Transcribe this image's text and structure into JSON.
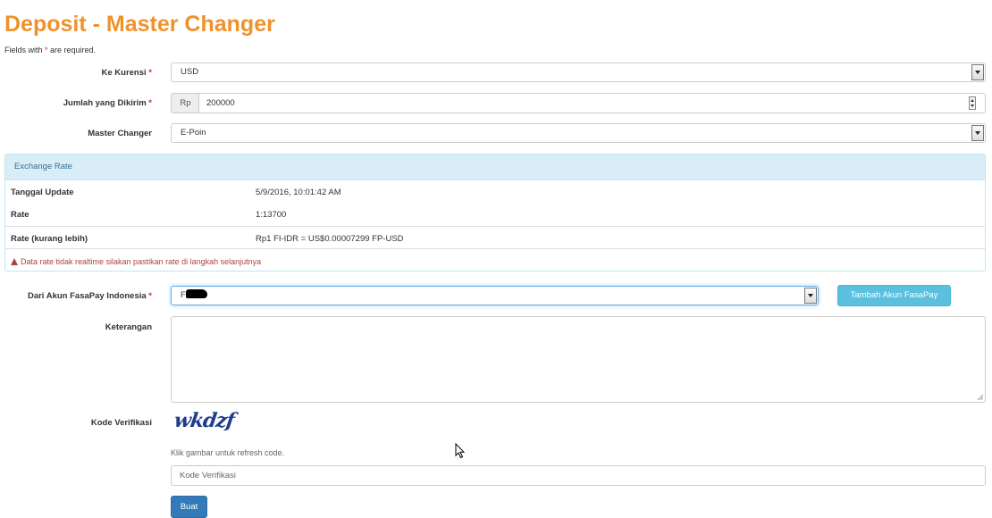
{
  "page": {
    "title": "Deposit - Master Changer",
    "required_note_prefix": "Fields with ",
    "required_note_star": "*",
    "required_note_suffix": " are required."
  },
  "form": {
    "currency": {
      "label": "Ke Kurensi",
      "value": "USD"
    },
    "amount": {
      "label": "Jumlah yang Dikirim",
      "prefix": "Rp",
      "value": "200000"
    },
    "master_changer": {
      "label": "Master Changer",
      "value": "E-Poin"
    },
    "account": {
      "label": "Dari Akun FasaPay Indonesia",
      "value": "FI"
    },
    "add_account_button": "Tambah Akun FasaPay",
    "notes": {
      "label": "Keterangan",
      "value": ""
    },
    "verification": {
      "label": "Kode Verifikasi",
      "captcha_text": "wkdzf",
      "help": "Klik gambar untuk refresh code.",
      "placeholder": "Kode Verifikasi"
    },
    "submit_button": "Buat",
    "required_star": "*"
  },
  "exchange_rate": {
    "heading": "Exchange Rate",
    "rows": [
      {
        "key": "Tanggal Update",
        "value": "5/9/2016, 10:01:42 AM"
      },
      {
        "key": "Rate",
        "value": "1:13700"
      },
      {
        "key": "Rate (kurang lebih)",
        "value": "Rp1 FI-IDR = US$0.00007299 FP-USD"
      }
    ],
    "warning": "Data rate tidak realtime silakan pastikan rate di langkah selanjutnya"
  },
  "colors": {
    "title": "#f0922b",
    "info_button": "#5bc0de",
    "primary_button": "#337ab7",
    "panel_heading": "#d9edf7",
    "warning_text": "#a94442"
  },
  "icons": [
    "chevron-down-icon",
    "spinner-icon",
    "warning-icon",
    "resize-grip-icon",
    "mouse-cursor-icon"
  ]
}
